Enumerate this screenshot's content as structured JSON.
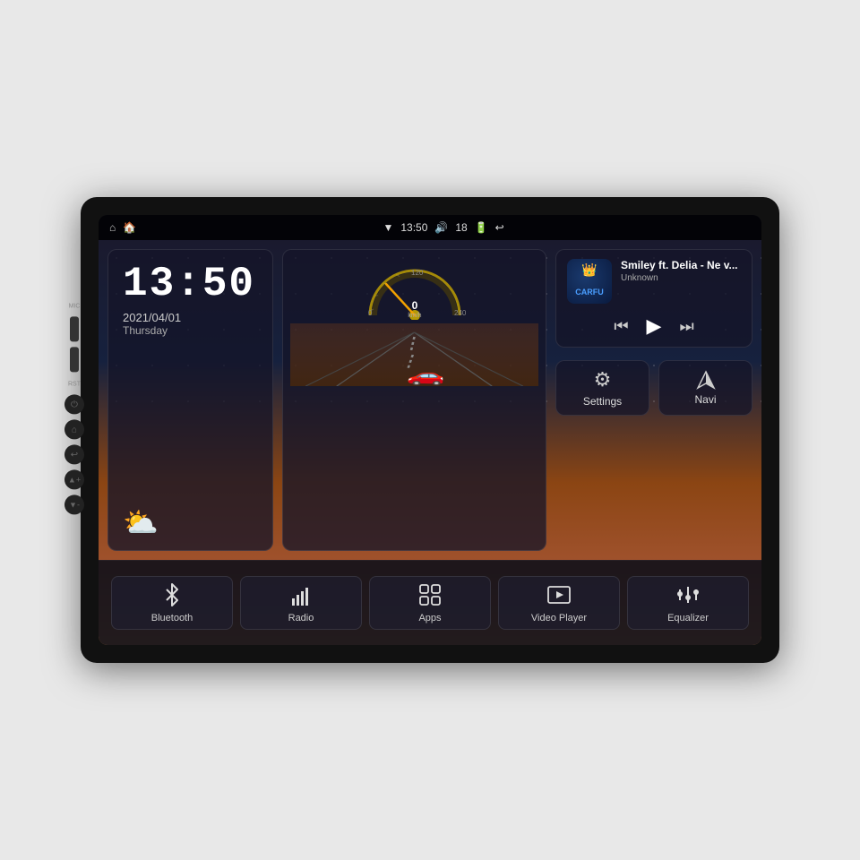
{
  "device": {
    "title": "Car Head Unit"
  },
  "status_bar": {
    "left_icons": [
      "home",
      "house"
    ],
    "time": "13:50",
    "wifi_icon": "wifi",
    "volume_icon": "volume",
    "volume_level": "18",
    "battery_icon": "battery",
    "back_icon": "back"
  },
  "clock_widget": {
    "time": "13:50",
    "date": "2021/04/01",
    "day": "Thursday"
  },
  "speed_widget": {
    "speed": "0",
    "unit": "km/h",
    "min_label": "0",
    "max_label": "240"
  },
  "music_widget": {
    "logo_text": "CARFU",
    "title": "Smiley ft. Delia - Ne v...",
    "artist": "Unknown",
    "prev_label": "⏮",
    "play_label": "▶",
    "next_label": "⏭"
  },
  "settings_btn": {
    "label": "Settings",
    "icon": "⚙"
  },
  "navi_btn": {
    "label": "Navi",
    "icon": "◭"
  },
  "bottom_nav": {
    "items": [
      {
        "id": "bluetooth",
        "label": "Bluetooth",
        "icon": "bluetooth"
      },
      {
        "id": "radio",
        "label": "Radio",
        "icon": "radio"
      },
      {
        "id": "apps",
        "label": "Apps",
        "icon": "apps"
      },
      {
        "id": "video-player",
        "label": "Video Player",
        "icon": "video"
      },
      {
        "id": "equalizer",
        "label": "Equalizer",
        "icon": "equalizer"
      }
    ]
  },
  "side_buttons": {
    "mic_label": "MIC",
    "rst_label": "RST"
  }
}
